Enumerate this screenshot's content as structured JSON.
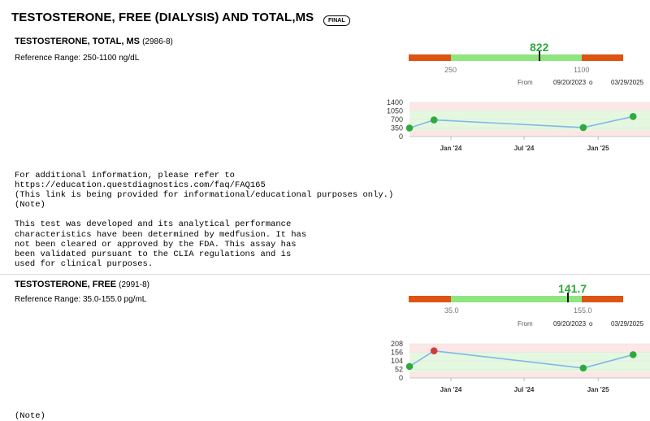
{
  "header": {
    "title": "TESTOSTERONE, FREE (DIALYSIS) AND TOTAL,MS",
    "status_badge": "FINAL"
  },
  "tests": [
    {
      "name": "TESTOSTERONE, TOTAL, MS",
      "code": "(2986-8)",
      "reference_range": "Reference Range: 250-1100 ng/dL",
      "value": "822",
      "range_low_label": "250",
      "range_high_label": "1100",
      "from_label": "From",
      "from_date": "09/20/2023",
      "to_label": "o",
      "to_date": "03/29/2025",
      "bar_fraction": {
        "low": 250,
        "high": 1100,
        "max": 1600,
        "value": 822
      },
      "chart_data": {
        "type": "line",
        "y_ticks": [
          "1400",
          "1050",
          "700",
          "350",
          "0"
        ],
        "ylim": [
          0,
          1400
        ],
        "x_ticks": [
          "Jan '24",
          "Jul '24",
          "Jan '25"
        ],
        "points": [
          {
            "date": "2023-09-20",
            "value": 350,
            "status": "normal"
          },
          {
            "date": "2023-11-20",
            "value": 680,
            "status": "normal"
          },
          {
            "date": "2024-11-25",
            "value": 370,
            "status": "normal"
          },
          {
            "date": "2025-03-29",
            "value": 822,
            "status": "normal"
          }
        ],
        "normal_band": [
          250,
          1100
        ]
      },
      "notes": "For additional information, please refer to\nhttps://education.questdiagnostics.com/faq/FAQ165\n(This link is being provided for informational/educational purposes only.)\n(Note)\n\nThis test was developed and its analytical performance\ncharacteristics have been determined by medfusion. It has\nnot been cleared or approved by the FDA. This assay has\nbeen validated pursuant to the CLIA regulations and is\nused for clinical purposes."
    },
    {
      "name": "TESTOSTERONE, FREE",
      "code": "(2991-8)",
      "reference_range": "Reference Range: 35.0-155.0 pg/mL",
      "value": "141.7",
      "range_low_label": "35.0",
      "range_high_label": "155.0",
      "from_label": "From",
      "from_date": "09/20/2023",
      "to_label": "o",
      "to_date": "03/29/2025",
      "bar_fraction": {
        "low": 35,
        "high": 155,
        "max": 200,
        "value": 141.7
      },
      "chart_data": {
        "type": "line",
        "y_ticks": [
          "208",
          "156",
          "104",
          "52",
          "0"
        ],
        "ylim": [
          0,
          208
        ],
        "x_ticks": [
          "Jan '24",
          "Jul '24",
          "Jan '25"
        ],
        "points": [
          {
            "date": "2023-09-20",
            "value": 70,
            "status": "normal"
          },
          {
            "date": "2023-11-20",
            "value": 165,
            "status": "high"
          },
          {
            "date": "2024-11-25",
            "value": 60,
            "status": "normal"
          },
          {
            "date": "2025-03-29",
            "value": 141.7,
            "status": "normal"
          }
        ],
        "normal_band": [
          35,
          155
        ]
      },
      "notes": "(Note)"
    }
  ],
  "colors": {
    "normal_point": "#2eaa3c",
    "high_point": "#d13b3b",
    "line": "#7fb8e8",
    "out_of_range": "#dd5511",
    "in_range": "#8fe57f"
  }
}
